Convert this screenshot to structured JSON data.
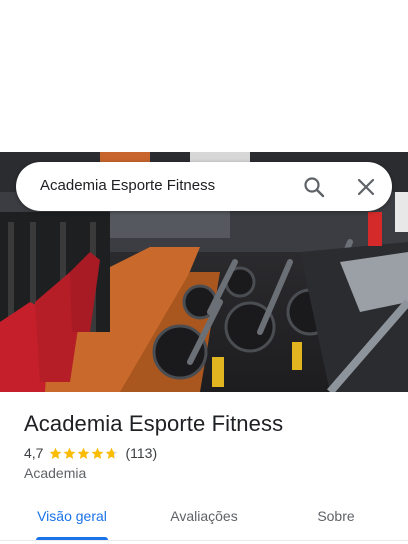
{
  "search": {
    "query": "Academia Esporte Fitness"
  },
  "place": {
    "name": "Academia Esporte Fitness",
    "rating": "4,7",
    "rating_fraction": 0.94,
    "reviews": "(113)",
    "category": "Academia"
  },
  "tabs": [
    {
      "label": "Visão geral",
      "selected": true
    },
    {
      "label": "Avaliações",
      "selected": false
    },
    {
      "label": "Sobre",
      "selected": false
    }
  ],
  "colors": {
    "accent": "#1a73e8",
    "star": "#fbbc04"
  },
  "icons": {
    "search": "search-icon",
    "close": "close-icon",
    "star": "star-icon"
  }
}
